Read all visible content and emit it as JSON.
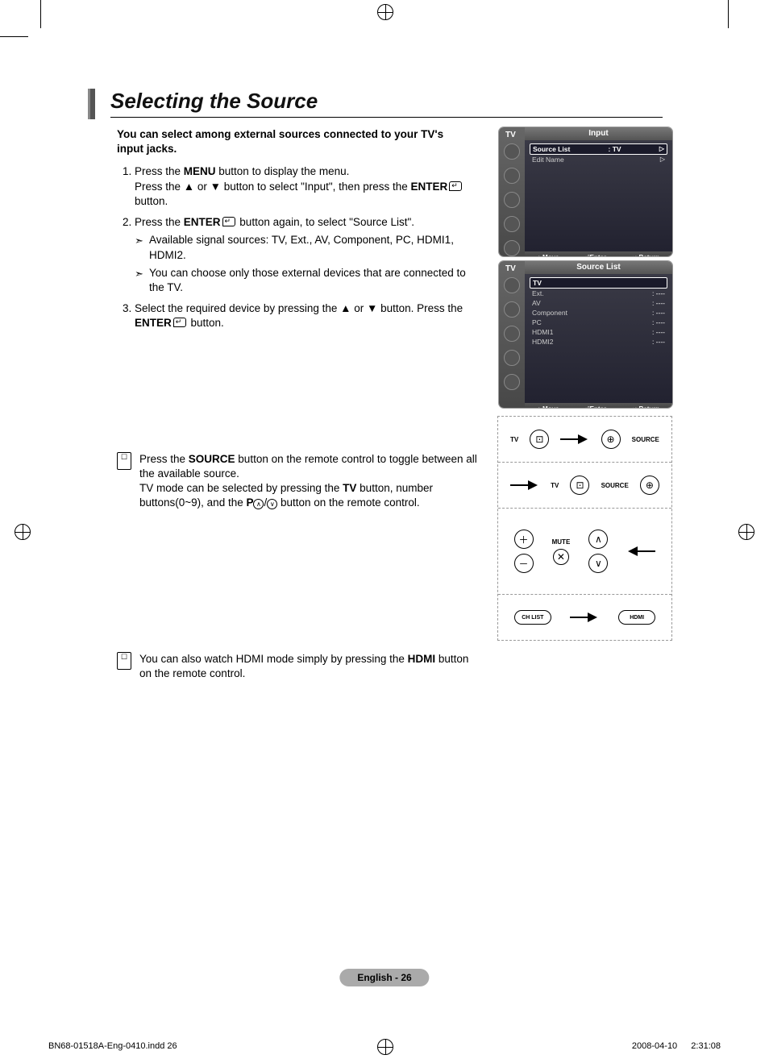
{
  "title": "Selecting the Source",
  "intro": "You can select among external sources connected to your TV's input jacks.",
  "steps": {
    "s1a": "Press the ",
    "s1a_bold": "MENU",
    "s1b": " button to display the menu.",
    "s1c": "Press the ▲ or ▼ button to select \"Input\", then press the ",
    "s1c_bold": "ENTER",
    "s1d": " button.",
    "s2a": "Press the ",
    "s2a_bold": "ENTER",
    "s2b": " button again, to select \"Source List\".",
    "s2_sub1": "Available signal sources:  TV, Ext., AV, Component, PC, HDMI1, HDMI2.",
    "s2_sub2": "You can choose only those external devices that are connected to the TV.",
    "s3a": "Select the required device by pressing the ▲ or ▼ button. Press the ",
    "s3a_bold": "ENTER",
    "s3b": " button."
  },
  "note1": {
    "a": "Press the ",
    "a_bold": "SOURCE",
    "b": " button on the remote control to toggle between all the available source.",
    "c": "TV mode can be selected by pressing the ",
    "c_bold": "TV",
    "d": " button, number buttons(0~9), and the ",
    "d_bold": "P",
    "e": " button on the remote control."
  },
  "note2": {
    "a": "You can also watch HDMI mode simply by pressing the ",
    "a_bold": "HDMI",
    "b": " button on the remote control."
  },
  "osd1": {
    "tv": "TV",
    "header": "Input",
    "source_list": "Source List",
    "source_val": ":  TV",
    "edit_name": "Edit Name",
    "move": "Move",
    "enter": "Enter",
    "return": "Return"
  },
  "osd2": {
    "tv": "TV",
    "header": "Source List",
    "items": [
      "TV",
      "Ext.",
      "AV",
      "Component",
      "PC",
      "HDMI1",
      "HDMI2"
    ],
    "val": ":  ----",
    "move": "Move",
    "enter": "Enter",
    "return": "Return"
  },
  "remote": {
    "tv_label": "TV",
    "source_label": "SOURCE",
    "mute_label": "MUTE",
    "chlist_label": "CH LIST",
    "hdmi_label": "HDMI"
  },
  "footer": "English - 26",
  "meta_left": "BN68-01518A-Eng-0410.indd   26",
  "meta_right": "2008-04-10     2:31:08"
}
